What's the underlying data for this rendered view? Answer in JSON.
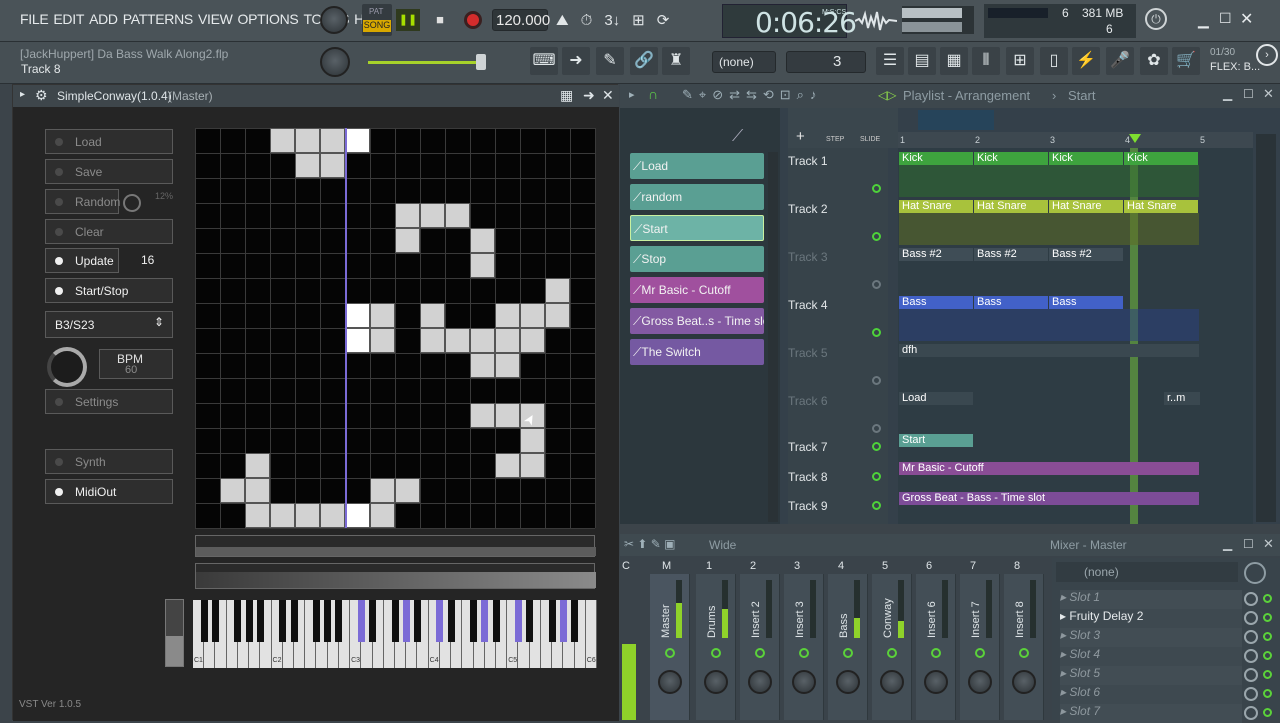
{
  "menu": [
    "FILE",
    "EDIT",
    "ADD",
    "PATTERNS",
    "VIEW",
    "OPTIONS",
    "TOOLS",
    "HELP"
  ],
  "transport": {
    "pat": "PAT",
    "song": "SONG",
    "tempo": "120.000",
    "time": "0:06:26",
    "time_unit": "M:S:CS"
  },
  "cpu": {
    "a": "6",
    "mem": "381 MB",
    "b": "6"
  },
  "hint": {
    "project": "[JackHuppert] Da Bass Walk Along2.flp",
    "track": "Track 8"
  },
  "snap": {
    "value": "(none)",
    "step": "3"
  },
  "news": {
    "count": "01/30",
    "text": "FLEX: B..."
  },
  "plugin": {
    "title": "SimpleConway(1.0.4)",
    "master": "(Master)",
    "buttons": [
      {
        "label": "Load",
        "on": false
      },
      {
        "label": "Save",
        "on": false
      },
      {
        "label": "Random",
        "on": false
      },
      {
        "label": "Clear",
        "on": false
      },
      {
        "label": "Update",
        "on": true
      },
      {
        "label": "Start/Stop",
        "on": true
      }
    ],
    "random_pct": "12%",
    "update_value": "16",
    "select": "B3/S23",
    "bpm_label": "BPM",
    "bpm_value": "60",
    "settings": "Settings",
    "synth": "Synth",
    "midiout": "MidiOut",
    "version": "VST Ver 1.0.5",
    "key_labels": [
      "C1",
      "C2",
      "C3",
      "C4",
      "C5",
      "C6"
    ]
  },
  "playlist": {
    "title": "Playlist - Arrangement",
    "crumb": "Start",
    "step": "STEP",
    "slide": "SLIDE",
    "bars": [
      "1",
      "2",
      "3",
      "4",
      "5"
    ],
    "picker": [
      {
        "label": "Load",
        "color": "#5a9f93"
      },
      {
        "label": "random",
        "color": "#5a9f93"
      },
      {
        "label": "Start",
        "color": "#6db3a6"
      },
      {
        "label": "Stop",
        "color": "#5a9f93"
      },
      {
        "label": "Mr Basic - Cutoff",
        "color": "#a0509e"
      },
      {
        "label": "Gross Beat..s - Time slot",
        "color": "#8359a2"
      },
      {
        "label": "The Switch",
        "color": "#7559a2"
      }
    ],
    "tracks": [
      {
        "name": "Track 1",
        "dim": false
      },
      {
        "name": "Track 2",
        "dim": false
      },
      {
        "name": "Track 3",
        "dim": true
      },
      {
        "name": "Track 4",
        "dim": false
      },
      {
        "name": "Track 5",
        "dim": true
      },
      {
        "name": "Track 6",
        "dim": true
      },
      {
        "name": "Track 7",
        "dim": false
      },
      {
        "name": "Track 8",
        "dim": false
      },
      {
        "name": "Track 9",
        "dim": false
      }
    ],
    "clips": {
      "kick": "Kick",
      "hat": "Hat Snare",
      "bass2": "Bass #2",
      "bass": "Bass",
      "dfh": "dfh",
      "load": "Load",
      "rm": "r..m",
      "start": "Start",
      "cutoff": "Mr Basic - Cutoff",
      "gross": "Gross Beat - Bass - Time slot"
    }
  },
  "mixer": {
    "title": "Mixer - Master",
    "mode": "Wide",
    "strips": [
      "Master",
      "Drums",
      "Insert 2",
      "Insert 3",
      "Bass",
      "Conway",
      "Insert 6",
      "Insert 7",
      "Insert 8"
    ],
    "numbers": [
      "C",
      "M",
      "1",
      "2",
      "3",
      "4",
      "5",
      "6",
      "7",
      "8"
    ],
    "route": "(none)",
    "slots": [
      "Slot 1",
      "Fruity Delay 2",
      "Slot 3",
      "Slot 4",
      "Slot 5",
      "Slot 6",
      "Slot 7"
    ]
  },
  "colors": {
    "kick": "#3ea33e",
    "hat": "#a8c23c",
    "bass": "#4261c8",
    "purple": "#8a4d96"
  }
}
